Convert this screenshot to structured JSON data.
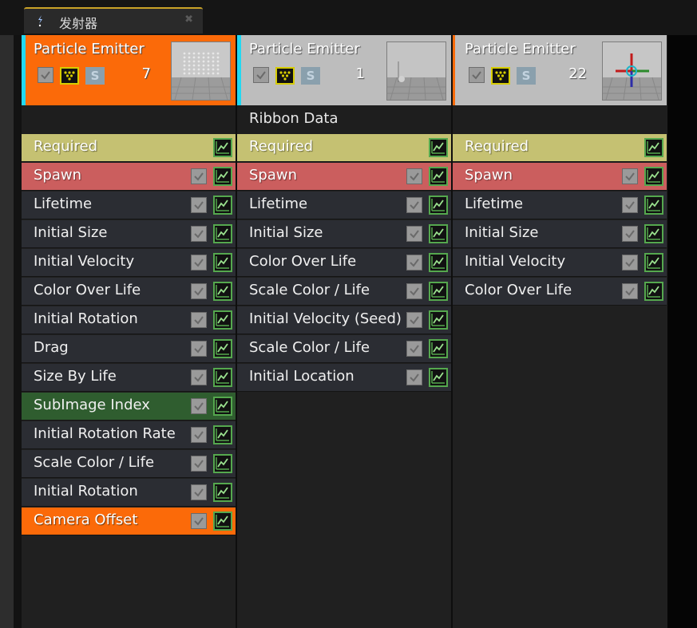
{
  "tab": {
    "title": "发射器",
    "icon": "emitter-icon",
    "close_icon": "close-icon"
  },
  "colors": {
    "orange": "#fb6a09",
    "required": "#c5c172",
    "spawn": "#cb5e5e",
    "selected_accent": "#21d9f2"
  },
  "emitters": [
    {
      "title": "Particle Emitter",
      "count": "7",
      "header_style": "orange",
      "selected": true,
      "subheader": null,
      "modules": [
        {
          "label": "Required",
          "style": "required",
          "has_check": false
        },
        {
          "label": "Spawn",
          "style": "spawn",
          "has_check": true
        },
        {
          "label": "Lifetime",
          "style": "normal",
          "has_check": true
        },
        {
          "label": "Initial Size",
          "style": "normal",
          "has_check": true
        },
        {
          "label": "Initial Velocity",
          "style": "normal",
          "has_check": true
        },
        {
          "label": "Color Over Life",
          "style": "normal",
          "has_check": true
        },
        {
          "label": "Initial Rotation",
          "style": "normal",
          "has_check": true
        },
        {
          "label": "Drag",
          "style": "normal",
          "has_check": true
        },
        {
          "label": "Size By Life",
          "style": "normal",
          "has_check": true
        },
        {
          "label": "SubImage Index",
          "style": "green",
          "has_check": true
        },
        {
          "label": "Initial Rotation Rate",
          "style": "normal",
          "has_check": true
        },
        {
          "label": "Scale Color / Life",
          "style": "normal",
          "has_check": true
        },
        {
          "label": "Initial Rotation",
          "style": "normal",
          "has_check": true
        },
        {
          "label": "Camera Offset",
          "style": "orange",
          "has_check": true
        }
      ]
    },
    {
      "title": "Particle Emitter",
      "count": "1",
      "header_style": "gray",
      "selected": true,
      "subheader": "Ribbon Data",
      "modules": [
        {
          "label": "Required",
          "style": "required",
          "has_check": false
        },
        {
          "label": "Spawn",
          "style": "spawn",
          "has_check": true
        },
        {
          "label": "Lifetime",
          "style": "normal",
          "has_check": true
        },
        {
          "label": "Initial Size",
          "style": "normal",
          "has_check": true
        },
        {
          "label": "Color Over Life",
          "style": "normal",
          "has_check": true
        },
        {
          "label": "Scale Color / Life",
          "style": "normal",
          "has_check": true
        },
        {
          "label": "Initial Velocity (Seed)",
          "style": "normal",
          "has_check": true
        },
        {
          "label": "Scale Color / Life",
          "style": "normal",
          "has_check": true
        },
        {
          "label": "Initial Location",
          "style": "normal",
          "has_check": true
        }
      ]
    },
    {
      "title": "Particle Emitter",
      "count": "22",
      "header_style": "gray",
      "selected": false,
      "subheader": null,
      "modules": [
        {
          "label": "Required",
          "style": "required",
          "has_check": false
        },
        {
          "label": "Spawn",
          "style": "spawn",
          "has_check": true
        },
        {
          "label": "Lifetime",
          "style": "normal",
          "has_check": true
        },
        {
          "label": "Initial Size",
          "style": "normal",
          "has_check": true
        },
        {
          "label": "Initial Velocity",
          "style": "normal",
          "has_check": true
        },
        {
          "label": "Color Over Life",
          "style": "normal",
          "has_check": true
        }
      ]
    }
  ]
}
